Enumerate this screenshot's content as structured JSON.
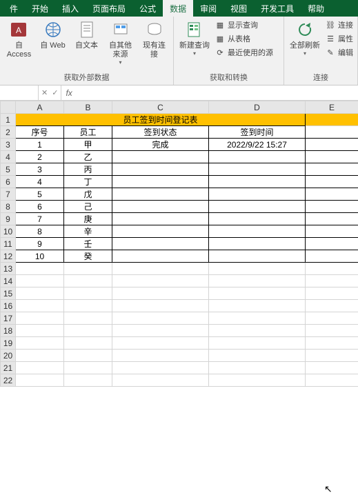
{
  "tabs": {
    "file": "件",
    "home": "开始",
    "insert": "插入",
    "layout": "页面布局",
    "formulas": "公式",
    "data": "数据",
    "review": "审阅",
    "view": "视图",
    "dev": "开发工具",
    "help": "帮助"
  },
  "ribbon": {
    "group1": {
      "access": "自 Access",
      "web": "自 Web",
      "text": "自文本",
      "other": "自其他来源",
      "conn": "现有连接",
      "label": "获取外部数据"
    },
    "group2": {
      "newquery": "新建查询",
      "showquery": "显示查询",
      "fromtable": "从表格",
      "recent": "最近使用的源",
      "label": "获取和转换"
    },
    "group3": {
      "refresh": "全部刷新",
      "connections": "连接",
      "props": "属性",
      "edit": "编辑",
      "label": "连接"
    }
  },
  "fx": {
    "name": "",
    "formula": ""
  },
  "cols": [
    "A",
    "B",
    "C",
    "D",
    "E"
  ],
  "sheet": {
    "title": "员工签到时间登记表",
    "headers": {
      "a": "序号",
      "b": "员工",
      "c": "签到状态",
      "d": "签到时间"
    },
    "rows": [
      {
        "n": "1",
        "emp": "甲",
        "status": "完成",
        "time": "2022/9/22 15:27"
      },
      {
        "n": "2",
        "emp": "乙",
        "status": "",
        "time": ""
      },
      {
        "n": "3",
        "emp": "丙",
        "status": "",
        "time": ""
      },
      {
        "n": "4",
        "emp": "丁",
        "status": "",
        "time": ""
      },
      {
        "n": "5",
        "emp": "戊",
        "status": "",
        "time": ""
      },
      {
        "n": "6",
        "emp": "己",
        "status": "",
        "time": ""
      },
      {
        "n": "7",
        "emp": "庚",
        "status": "",
        "time": ""
      },
      {
        "n": "8",
        "emp": "辛",
        "status": "",
        "time": ""
      },
      {
        "n": "9",
        "emp": "壬",
        "status": "",
        "time": ""
      },
      {
        "n": "10",
        "emp": "癸",
        "status": "",
        "time": ""
      }
    ]
  },
  "chart_data": {
    "type": "table",
    "title": "员工签到时间登记表",
    "columns": [
      "序号",
      "员工",
      "签到状态",
      "签到时间"
    ],
    "rows": [
      [
        "1",
        "甲",
        "完成",
        "2022/9/22 15:27"
      ],
      [
        "2",
        "乙",
        "",
        ""
      ],
      [
        "3",
        "丙",
        "",
        ""
      ],
      [
        "4",
        "丁",
        "",
        ""
      ],
      [
        "5",
        "戊",
        "",
        ""
      ],
      [
        "6",
        "己",
        "",
        ""
      ],
      [
        "7",
        "庚",
        "",
        ""
      ],
      [
        "8",
        "辛",
        "",
        ""
      ],
      [
        "9",
        "壬",
        "",
        ""
      ],
      [
        "10",
        "癸",
        "",
        ""
      ]
    ]
  }
}
